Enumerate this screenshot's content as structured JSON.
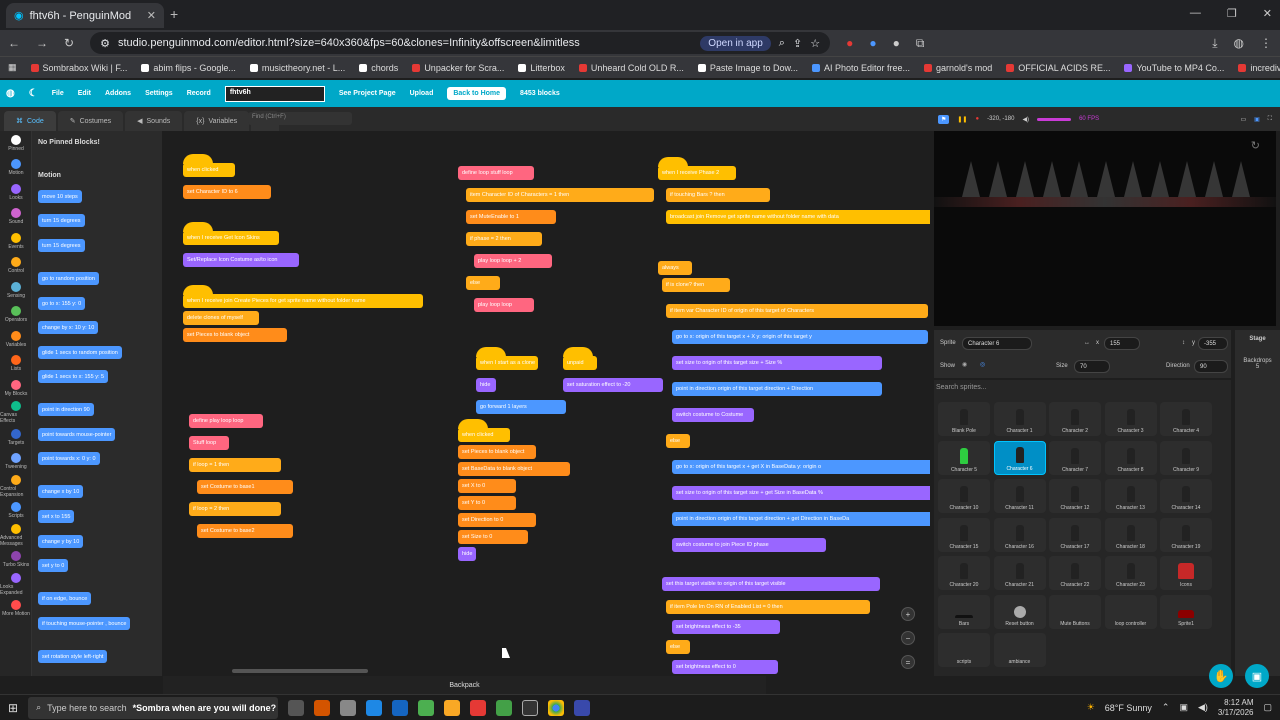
{
  "browser": {
    "tab_title": "fhtv6h - PenguinMod",
    "url": "studio.penguinmod.com/editor.html?size=640x360&fps=60&clones=Infinity&offscreen&limitless",
    "open_in_app": "Open in app",
    "bookmarks": [
      "Sombrabox Wiki | F...",
      "abim flips - Google...",
      "musictheory.net - L...",
      "chords",
      "Unpacker for Scra...",
      "Litterbox",
      "Unheard Cold OLD R...",
      "Paste Image to Dow...",
      "AI Photo Editor free...",
      "garnold's mod",
      "OFFICIAL ACIDS RE...",
      "YouTube to MP4 Co...",
      "incredivoc"
    ]
  },
  "menubar": {
    "items": [
      "File",
      "Edit",
      "Addons",
      "Settings",
      "Record"
    ],
    "project_title": "fhtv6h",
    "see_project_page": "See Project Page",
    "upload": "Upload",
    "back_to_home": "Back to Home",
    "block_count": "8453 blocks"
  },
  "editor_tabs": [
    "Code",
    "Costumes",
    "Sounds",
    "Variables"
  ],
  "find_placeholder": "Find (Ctrl+F)",
  "categories": [
    {
      "label": "Pinned",
      "color": "#ffffff"
    },
    {
      "label": "Motion",
      "color": "#4c97ff"
    },
    {
      "label": "Looks",
      "color": "#9966ff"
    },
    {
      "label": "Sound",
      "color": "#cf63cf"
    },
    {
      "label": "Events",
      "color": "#ffbf00"
    },
    {
      "label": "Control",
      "color": "#ffab19"
    },
    {
      "label": "Sensing",
      "color": "#5cb1d6"
    },
    {
      "label": "Operators",
      "color": "#59c059"
    },
    {
      "label": "Variables",
      "color": "#ff8c1a"
    },
    {
      "label": "Lists",
      "color": "#ff661a"
    },
    {
      "label": "My Blocks",
      "color": "#ff6680"
    },
    {
      "label": "Canvas Effects",
      "color": "#0fbd8c"
    },
    {
      "label": "Targets",
      "color": "#3366cc"
    },
    {
      "label": "Tweening",
      "color": "#6fa3ff"
    },
    {
      "label": "Control Expansion",
      "color": "#ffab19"
    },
    {
      "label": "Scripts",
      "color": "#4c97ff"
    },
    {
      "label": "Advanced Messages",
      "color": "#ffbf00"
    },
    {
      "label": "Turbo Skins",
      "color": "#8e44ad"
    },
    {
      "label": "Looks Expanded",
      "color": "#9966ff"
    },
    {
      "label": "More Motion",
      "color": "#ff4c4c"
    }
  ],
  "palette": {
    "pinned_text": "No Pinned Blocks!",
    "motion_header": "Motion",
    "blocks": [
      "move 10 steps",
      "turn 15 degrees",
      "turn 15 degrees",
      "go to random position",
      "go to x: 155 y: 0",
      "change by x: 10 y: 10",
      "glide 1 secs to random position",
      "glide 1 secs to x: 155 y: 5",
      "point in direction 90",
      "point towards mouse-pointer",
      "point towards x: 0 y: 0",
      "change x by 10",
      "set x to 155",
      "change y by 10",
      "set y to 0",
      "if on edge, bounce",
      "if touching mouse-pointer , bounce",
      "set rotation style left-right"
    ]
  },
  "scripts": {
    "s1": [
      "when clicked",
      "set Character ID to 6"
    ],
    "s2": [
      "when I receive Get Icon Skins",
      "Set/Replace Icon Costume as/to icon"
    ],
    "s3": [
      "when I receive join Create Pieces for get sprite name without folder name",
      "delete clones of myself",
      "set Pieces to blank object"
    ],
    "s4": [
      "define play loop loop",
      "Stuff loop",
      "if loop = 1 then",
      "set Costume to base1",
      "if loop = 2 then",
      "set Costume to base2"
    ],
    "s5": [
      "define loop stuff loop",
      "item Character ID of Characters = 1 then",
      "set MuteEnable to 1",
      "if phase = 2 then",
      "play loop loop + 2",
      "else",
      "play loop loop"
    ],
    "s6": [
      "when I start as a clone",
      "hide",
      "go forward 1 layers"
    ],
    "s7": [
      "unpaid",
      "set saturation effect to -20"
    ],
    "s8": [
      "when clicked",
      "set Pieces to blank object",
      "set BaseData to blank object",
      "set X to 0",
      "set Y to 0",
      "set Direction to 0",
      "set Size to 0",
      "hide"
    ],
    "s9": [
      "when I receive Phase 2",
      "if touching Bars ? then",
      "broadcast join Remove get sprite name without folder name with data"
    ],
    "s10": [
      "always",
      "if is clone? then",
      "if item var Character ID of origin of this target of Characters",
      "go to x: origin of this target x + X y: origin of this target y",
      "set size to origin of this target size + Size %",
      "point in direction origin of this target direction + Direction",
      "switch costume to Costume",
      "else",
      "go to x: origin of this target x + get X in BaseData y: origin o",
      "set size to origin of this target size + get Size in BaseData %",
      "point in direction origin of this target direction + get Direction in BaseDa",
      "switch costume to join Piece ID phase",
      "set this target visible to origin of this target visible",
      "if item Pole Im On RN of Enabled List = 0 then",
      "set brightness effect to -35",
      "else",
      "set brightness effect to 0"
    ]
  },
  "backpack": "Backpack",
  "stage_controls": {
    "coords": "-320, -180",
    "fps": "60 FPS"
  },
  "sprite_info": {
    "sprite_label": "Sprite",
    "sprite_name": "Character 6",
    "x_label": "x",
    "x": "155",
    "y_label": "y",
    "y": "-355",
    "show_label": "Show",
    "size_label": "Size",
    "size": "70",
    "direction_label": "Direction",
    "direction": "90"
  },
  "sprite_search": "Search sprites...",
  "sprites": [
    "Blank Pole",
    "Character 1",
    "Character 2",
    "Character 3",
    "Character 4",
    "Character 5",
    "Character 6",
    "Character 7",
    "Character 8",
    "Character 9",
    "Character 10",
    "Character 11",
    "Character 12",
    "Character 13",
    "Character 14",
    "Character 15",
    "Character 16",
    "Character 17",
    "Character 18",
    "Character 19",
    "Character 20",
    "Character 21",
    "Character 22",
    "Character 23",
    "Icons",
    "Bars",
    "Reset button",
    "Mute Buttons",
    "loop controller",
    "Sprite1",
    "scripts",
    "ambiance"
  ],
  "stage_panel": {
    "label": "Stage",
    "backdrops_label": "Backdrops",
    "backdrops": "5"
  },
  "taskbar": {
    "search": "Type here to search",
    "sombra_text": "*Sombra when are you will done?",
    "weather": "68°F  Sunny",
    "time": "8:12 AM",
    "date": "3/17/2026"
  },
  "colors": {
    "accent": "#00a8c8",
    "events": "#ffbf00",
    "control": "#ffab19",
    "looks": "#9966ff",
    "motion": "#4c97ff",
    "variables": "#ff8c1a",
    "operators": "#59c059",
    "myblocks": "#ff6680"
  }
}
